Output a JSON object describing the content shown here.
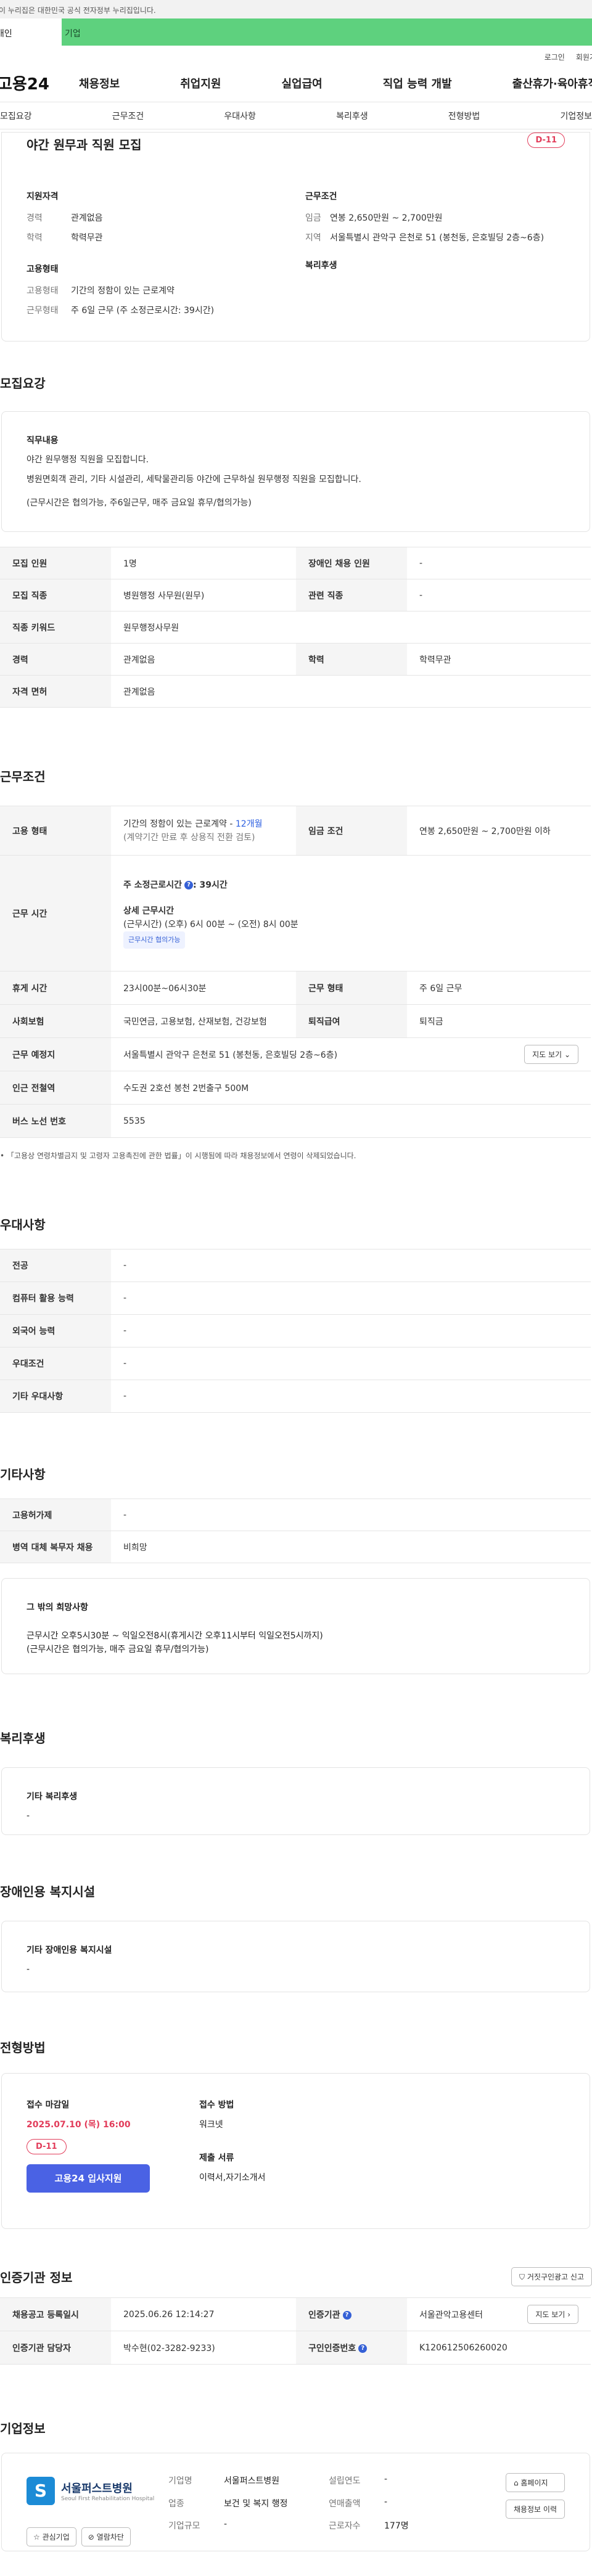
{
  "gov_bar": "이 누리집은 대한민국 공식 전자정부 누리집입니다.",
  "tabs": {
    "person": "개인",
    "biz": "기업"
  },
  "util": {
    "login": "로그인",
    "signup": "회원가입"
  },
  "gnb": {
    "logo": "고용24",
    "items": [
      "채용정보",
      "취업지원",
      "실업급여",
      "직업 능력 개발",
      "출산휴가·육아휴직"
    ]
  },
  "subnav": [
    "모집요강",
    "근무조건",
    "우대사항",
    "복리후생",
    "전형방법",
    "기업정보"
  ],
  "hero": {
    "title": "야간 원무과 직원 모집",
    "dday": "D-11",
    "qual_title": "지원자격",
    "qual": [
      {
        "k": "경력",
        "v": "관계없음"
      },
      {
        "k": "학력",
        "v": "학력무관"
      }
    ],
    "emp_title": "고용형태",
    "emp": [
      {
        "k": "고용형태",
        "v": "기간의 정함이 있는 근로계약"
      },
      {
        "k": "근무형태",
        "v": "주 6일 근무 (주 소정근로시간: 39시간)"
      }
    ],
    "cond_title": "근무조건",
    "cond": [
      {
        "k": "임금",
        "v": "연봉 2,650만원 ~ 2,700만원"
      },
      {
        "k": "지역",
        "v": "서울특별시 관악구 은천로 51 (봉천동, 은호빌딩 2층~6층)"
      }
    ],
    "welfare_title": "복리후생"
  },
  "recruit": {
    "title": "모집요강",
    "note_title": "직무내용",
    "note_lines": [
      "야간 원무행정 직원을 모집합니다.",
      "병원면회객 관리, 기타 시설관리, 세탁물관리등 야간에 근무하실 원무행정 직원을 모집합니다.",
      "(근무시간은 협의가능, 주6일근무, 매주 금요일 휴무/협의가능)"
    ],
    "rows": [
      {
        "k1": "모집 인원",
        "v1": "1명",
        "k2": "장애인 채용 인원",
        "v2": "-"
      },
      {
        "k1": "모집 직종",
        "v1": "병원행정 사무원(원무)",
        "k2": "관련 직종",
        "v2": "-"
      },
      {
        "k1": "직종 키워드",
        "v1": "원무행정사무원"
      },
      {
        "k1": "경력",
        "v1": "관계없음",
        "k2": "학력",
        "v2": "학력무관"
      },
      {
        "k1": "자격 면허",
        "v1": "관계없음"
      }
    ]
  },
  "work": {
    "title": "근무조건",
    "emp_type_k": "고용 형태",
    "emp_type_v": "기간의 정함이 있는 근로계약 -",
    "emp_type_months": "12개월",
    "emp_type_note": "(계약기간 만료 후 상용직 전환 검토)",
    "wage_k": "임금 조건",
    "wage_v": "연봉 2,650만원 ~ 2,700만원 이하",
    "hours_k": "근무 시간",
    "hours_weekly_label": "주 소정근로시간",
    "hours_weekly_value": ": 39시간",
    "hours_detail_label": "상세 근무시간",
    "hours_detail_value": "(근무시간) (오후) 6시 00분 ~ (오전) 8시 00분",
    "hours_badge": "근무시간 협의가능",
    "break_k": "휴게 시간",
    "break_v": "23시00분~06시30분",
    "shift_k": "근무 형태",
    "shift_v": "주 6일 근무",
    "ins_k": "사회보험",
    "ins_v": "국민연금, 고용보험, 산재보험, 건강보험",
    "sev_k": "퇴직급여",
    "sev_v": "퇴직금",
    "loc_k": "근무 예정지",
    "loc_v": "서울특별시 관악구 은천로 51 (봉천동, 은호빌딩 2층~6층)",
    "map_btn": "지도 보기",
    "subway_k": "인근 전철역",
    "subway_v": "수도권 2호선 봉천 2번출구 500M",
    "bus_k": "버스 노선 번호",
    "bus_v": "5535",
    "footnote": "「고용상 연령차별금지 및 고령자 고용촉진에 관한 법률」이 시행됨에 따라 채용정보에서 연령이 삭제되었습니다."
  },
  "prefer": {
    "title": "우대사항",
    "rows": [
      {
        "k": "전공",
        "v": "-"
      },
      {
        "k": "컴퓨터 활용 능력",
        "v": "-"
      },
      {
        "k": "외국어 능력",
        "v": "-"
      },
      {
        "k": "우대조건",
        "v": "-"
      },
      {
        "k": "기타 우대사항",
        "v": "-"
      }
    ]
  },
  "etc": {
    "title": "기타사항",
    "rows": [
      {
        "k": "고용허가제",
        "v": "-"
      },
      {
        "k": "병역 대체 복무자 채용",
        "v": "비희망"
      }
    ],
    "box_title": "그 밖의 희망사항",
    "box_lines": [
      "근무시간 오후5시30분 ~ 익일오전8시(휴게시간 오후11시부터 익일오전5시까지)",
      "(근무시간은 협의가능, 매주 금요일 휴무/협의가능)"
    ]
  },
  "welfare": {
    "title": "복리후생",
    "box_title": "기타 복리후생",
    "box_value": "-"
  },
  "disabled": {
    "title": "장애인용 복지시설",
    "box_title": "기타 장애인용 복지시설",
    "box_value": "-"
  },
  "apply": {
    "title": "전형방법",
    "deadline_label": "접수 마감일",
    "deadline": "2025.07.10 (목) 16:00",
    "dday": "D-11",
    "apply_btn": "고용24 입사지원",
    "method_label": "접수 방법",
    "method": "워크넷",
    "docs_label": "제출 서류",
    "docs": "이력서,자기소개서"
  },
  "agency": {
    "title": "인증기관 정보",
    "report_btn": "거짓구인광고 신고",
    "reg_k": "채용공고 등록일시",
    "reg_v": "2025.06.26 12:14:27",
    "agency_k": "인증기관",
    "agency_v": "서울관악고용센터",
    "map_btn": "지도 보기",
    "manager_k": "인증기관 담당자",
    "manager_v": "박수현(02-3282-9233)",
    "num_k": "구인인증번호",
    "num_v": "K120612506260020"
  },
  "company": {
    "title": "기업정보",
    "name": "서울퍼스트병원",
    "sub": "Seoul First Rehabilitation Hospital",
    "fav_btn": "관심기업",
    "follow_btn": "열람차단",
    "info": [
      {
        "k": "기업명",
        "v": "서울퍼스트병원",
        "k2": "설립연도",
        "v2": "-"
      },
      {
        "k": "업종",
        "v": "보건 및 복지 행정",
        "k2": "연매출액",
        "v2": "-"
      },
      {
        "k": "기업규모",
        "v": "-",
        "k2": "근로자수",
        "v2": "177명"
      }
    ],
    "home_btn": "홈페이지",
    "history_btn": "채용정보 이력"
  }
}
